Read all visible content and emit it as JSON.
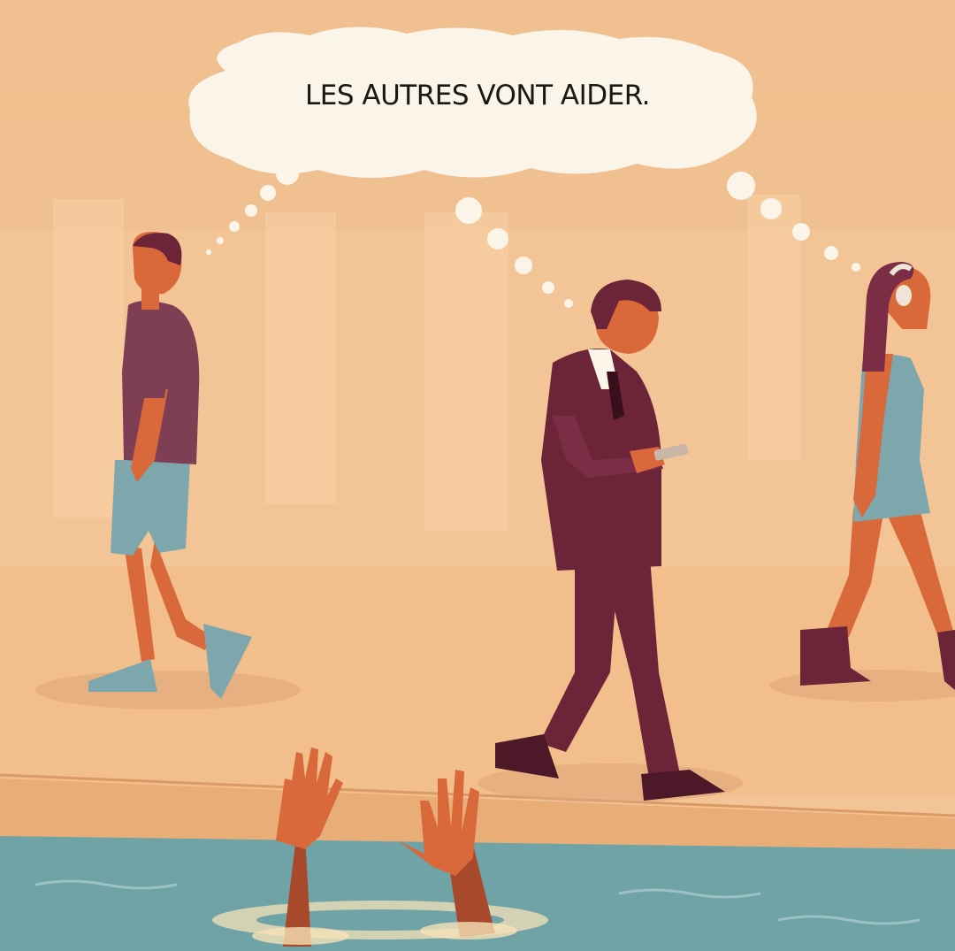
{
  "thought_bubble": {
    "text": "LES AUTRES VONT AIDER."
  },
  "colors": {
    "background": "#f3c596",
    "sidewalk": "#f0b987",
    "curb": "#e9ad78",
    "water": "#6fa3a6",
    "skin": "#d9683a",
    "shirt": "#7e3f55",
    "shorts": "#7ea7ad",
    "suit": "#6b2438",
    "bubble": "#fbf4e9",
    "text": "#1b1714"
  },
  "icons": [
    "thought-bubble-icon",
    "smartphone-icon",
    "headphones-icon"
  ]
}
